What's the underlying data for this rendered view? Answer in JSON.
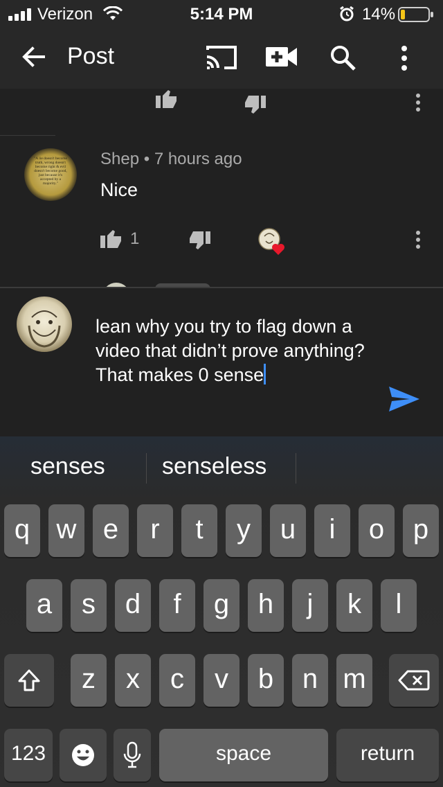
{
  "status_bar": {
    "carrier": "Verizon",
    "time": "5:14 PM",
    "battery_pct": "14%"
  },
  "app_bar": {
    "title": "Post"
  },
  "comment": {
    "author": "Shep",
    "age": "7 hours ago",
    "text": "Nice",
    "likes": "1",
    "avatar_quote": "\"A lie doesn't become truth, wrong doesn't become right & evil doesn't become good, just because it's accepted by a majority.\""
  },
  "composer": {
    "text": "lean why you try to flag down a video that didn’t prove anything? That makes 0 sense"
  },
  "keyboard": {
    "suggestions": [
      "senses",
      "senseless"
    ],
    "row1": [
      "q",
      "w",
      "e",
      "r",
      "t",
      "y",
      "u",
      "i",
      "o",
      "p"
    ],
    "row2": [
      "a",
      "s",
      "d",
      "f",
      "g",
      "h",
      "j",
      "k",
      "l"
    ],
    "row3": [
      "z",
      "x",
      "c",
      "v",
      "b",
      "n",
      "m"
    ],
    "numbers_label": "123",
    "space_label": "space",
    "return_label": "return"
  },
  "colors": {
    "background": "#212121",
    "bar": "#282828",
    "accent_blue": "#3e8ef7",
    "heart_red": "#e8182b",
    "key": "#636363",
    "key_dark": "#464646"
  }
}
